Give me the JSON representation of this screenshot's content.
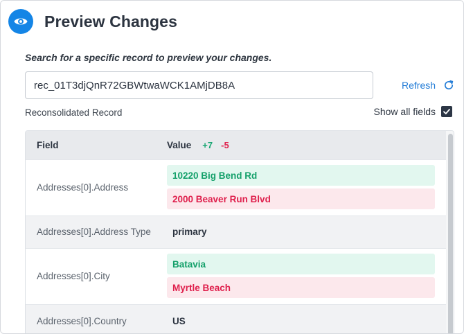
{
  "header": {
    "title": "Preview Changes",
    "icon": "eye-icon",
    "accent": "#1485e6"
  },
  "search": {
    "instruction": "Search for a specific record to preview your changes.",
    "value": "rec_01T3djQnR72GBWtwaWCK1AMjDB8A",
    "refresh_label": "Refresh"
  },
  "record": {
    "label": "Reconsolidated Record",
    "show_all_label": "Show all fields",
    "show_all_checked": true
  },
  "table": {
    "col_field": "Field",
    "col_value": "Value",
    "added_count": "+7",
    "removed_count": "-5",
    "rows": [
      {
        "field": "Addresses[0].Address",
        "added": "10220 Big Bend Rd",
        "removed": "2000 Beaver Run Blvd"
      },
      {
        "field": "Addresses[0].Address Type",
        "value": "primary"
      },
      {
        "field": "Addresses[0].City",
        "added": "Batavia",
        "removed": "Myrtle Beach"
      },
      {
        "field": "Addresses[0].Country",
        "value": "US"
      }
    ]
  },
  "colors": {
    "added": "#14a06a",
    "removed": "#df1f4c",
    "added_bg": "#e2f7ef",
    "removed_bg": "#fce8ec",
    "link": "#1f7ad6"
  }
}
